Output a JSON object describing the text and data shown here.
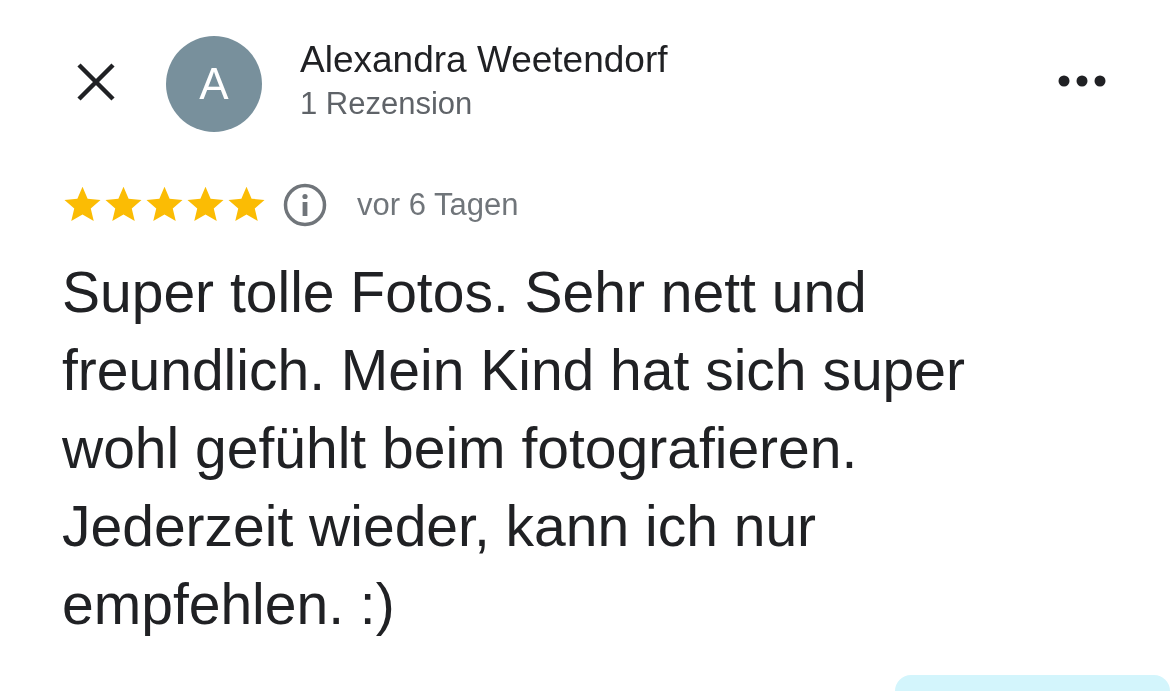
{
  "reviewer": {
    "name": "Alexandra Weetendorf",
    "initial": "A",
    "review_count": "1 Rezension"
  },
  "review": {
    "stars": 5,
    "time": "vor 6 Tagen",
    "text": "Super tolle Fotos. Sehr nett und freundlich. Mein Kind hat sich super wohl gefühlt beim fotografieren. Jederzeit wieder, kann ich nur empfehlen. :)"
  }
}
